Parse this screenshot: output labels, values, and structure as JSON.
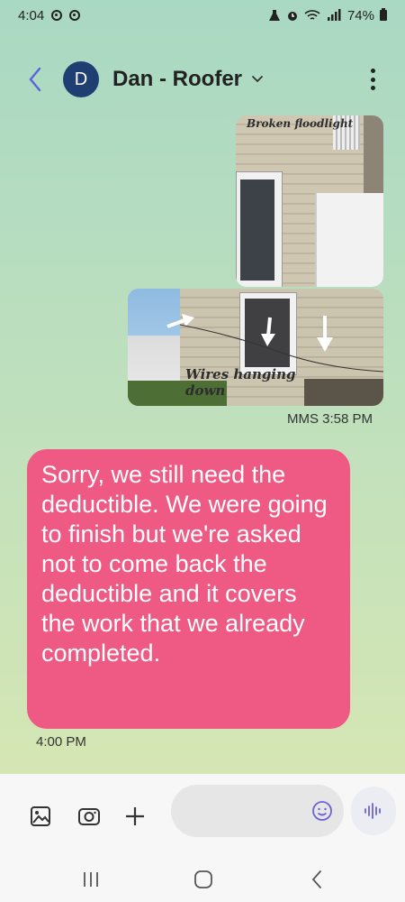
{
  "status_bar": {
    "time": "4:04",
    "battery": "74%"
  },
  "header": {
    "avatar_letter": "D",
    "contact_name": "Dan - Roofer"
  },
  "messages": {
    "photo1_caption": "Broken floodlight",
    "photo2_caption_line1": "Wires hanging",
    "photo2_caption_line2": "down",
    "mms_timestamp": "MMS 3:58 PM",
    "bubble_text": "Sorry, we still need the deductible. We were going to finish but we're asked not to come back the deductible and it covers the work that we already completed.",
    "bubble_time": "4:00 PM"
  },
  "composer": {
    "placeholder": ""
  },
  "colors": {
    "bubble": "#ef5a85",
    "avatar": "#1f3f73",
    "accent": "#6b63d6"
  }
}
